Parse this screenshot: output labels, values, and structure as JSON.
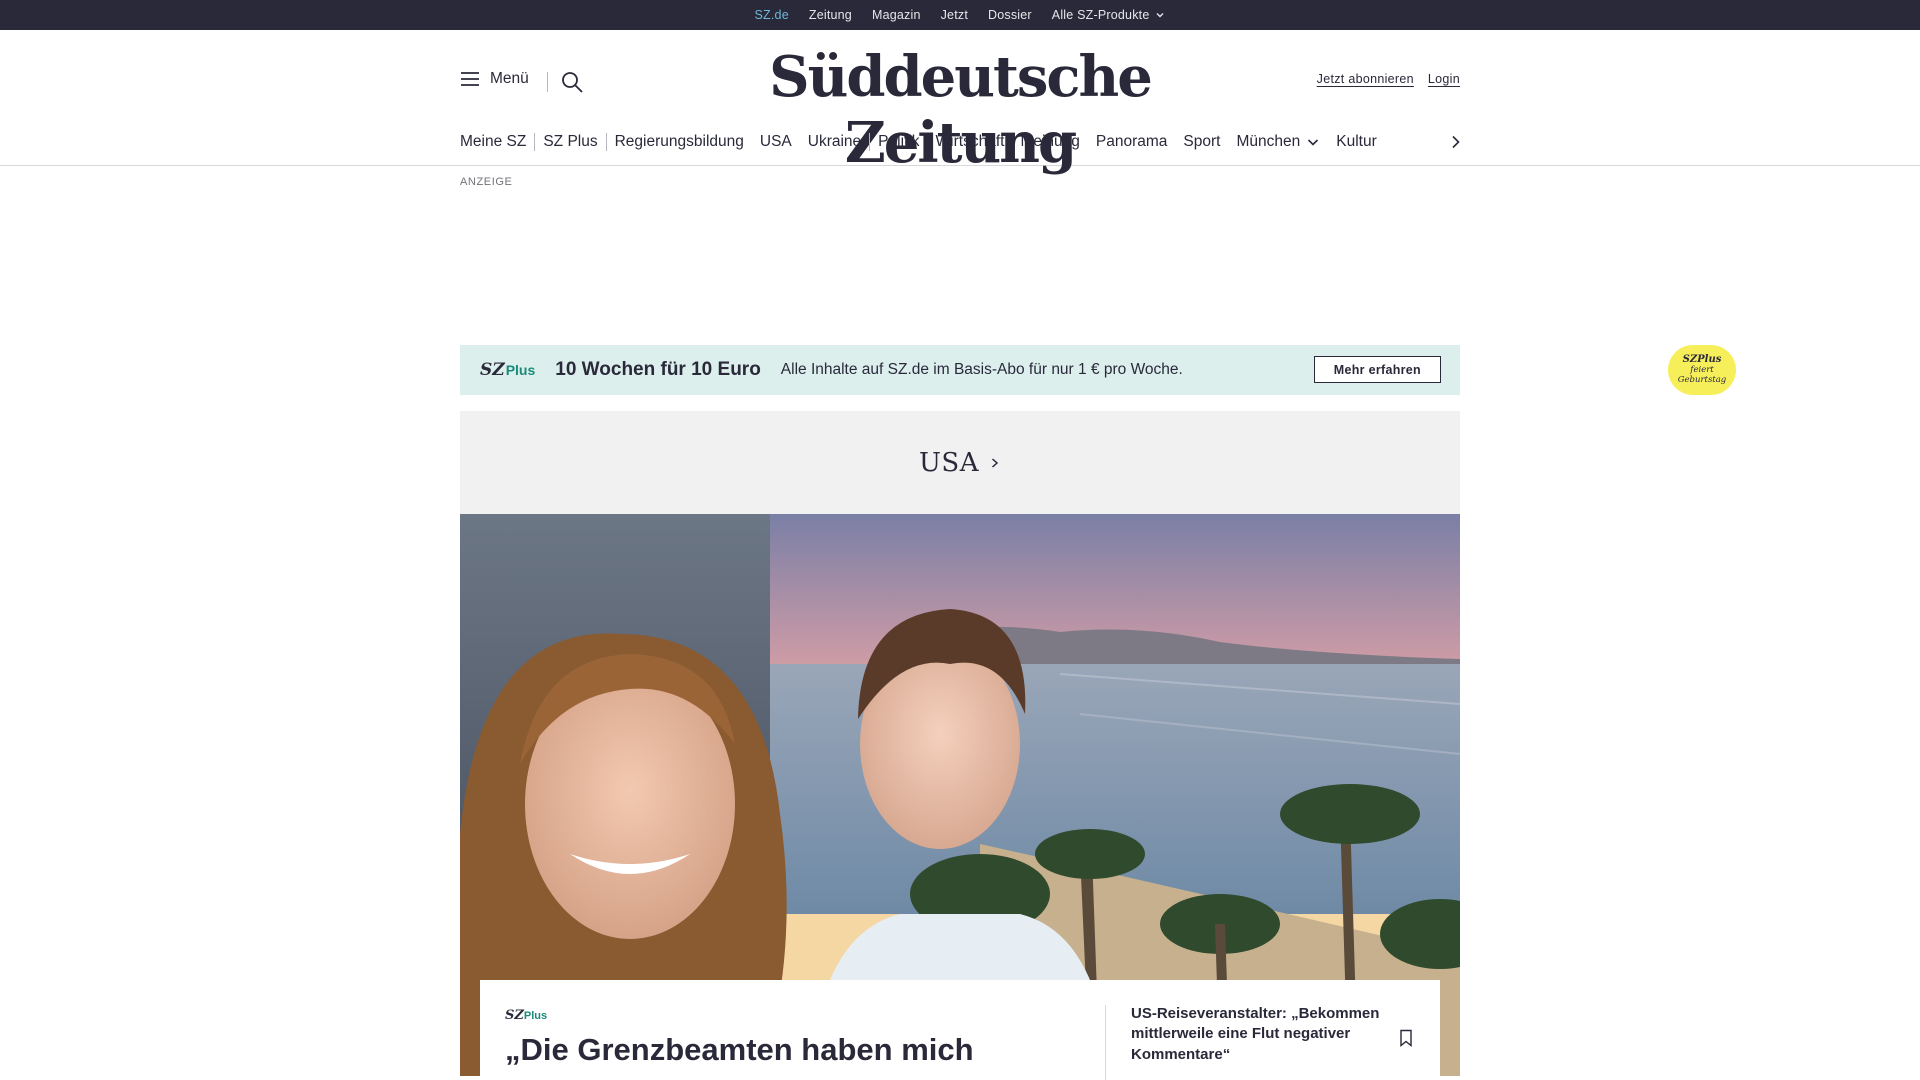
{
  "topbar": {
    "items": [
      "SZ.de",
      "Zeitung",
      "Magazin",
      "Jetzt",
      "Dossier",
      "Alle SZ-Produkte"
    ],
    "active_index": 0
  },
  "header": {
    "menu_label": "Menü",
    "logo": "Süddeutsche Zeitung",
    "subscribe_label": "Jetzt abonnieren",
    "login_label": "Login"
  },
  "mainnav": {
    "items": [
      "Meine SZ",
      "SZ Plus",
      "Regierungsbildung",
      "USA",
      "Ukraine",
      "Politik",
      "Wirtschaft",
      "Meinung",
      "Panorama",
      "Sport",
      "München",
      "Kultur"
    ]
  },
  "ad": {
    "label": "ANZEIGE"
  },
  "promo": {
    "logo_sz": "SZ",
    "logo_plus": "Plus",
    "title": "10 Wochen für 10 Euro",
    "text": "Alle Inhalte auf SZ.de im Basis-Abo für nur 1 € pro Woche.",
    "badge_logo": "SZPlus",
    "badge_line1": "feiert",
    "badge_line2": "Geburtstag",
    "button_label": "Mehr erfahren"
  },
  "section": {
    "title": "USA"
  },
  "teaser": {
    "plus_sz": "SZ",
    "plus_label": "Plus",
    "headline": "„Die Grenzbeamten haben mich",
    "side_headline": "US-Reiseveranstalter: „Bekommen mittlerweile eine Flut negativer Kommentare“"
  },
  "colors": {
    "topbar_bg": "#29293a",
    "topbar_active": "#6fb8d7",
    "promo_bg": "#dcefed",
    "badge": "#f7ef5a",
    "plus_accent": "#1a8a7a",
    "section_bg": "#f1f1f1"
  },
  "icons": [
    "hamburger-icon",
    "search-icon",
    "chevron-down-icon",
    "chevron-right-icon",
    "bookmark-icon"
  ]
}
